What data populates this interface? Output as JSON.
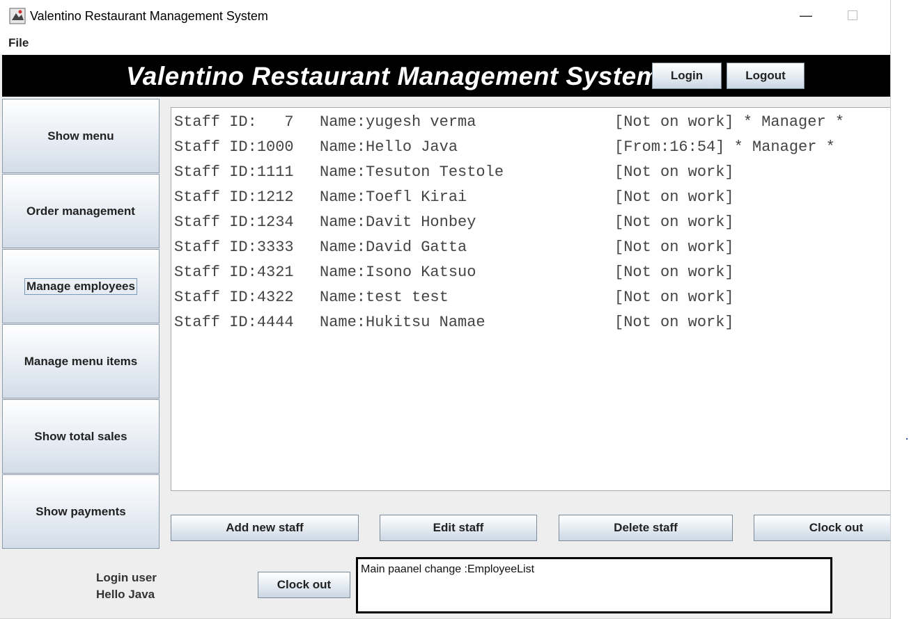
{
  "window": {
    "title": "Valentino Restaurant Management System",
    "minimize_glyph": "—"
  },
  "menubar": {
    "file_label": "File"
  },
  "banner": {
    "title": "Valentino Restaurant Management System",
    "login_label": "Login",
    "logout_label": "Logout"
  },
  "sidebar": {
    "items": [
      {
        "label": "Show menu"
      },
      {
        "label": "Order management"
      },
      {
        "label": "Manage employees"
      },
      {
        "label": "Manage menu items"
      },
      {
        "label": "Show total sales"
      },
      {
        "label": "Show payments"
      }
    ]
  },
  "staff_list": {
    "rows": [
      {
        "id": "Staff ID:   7",
        "name": "Name:yugesh verma",
        "status": "[Not on work] * Manager *"
      },
      {
        "id": "Staff ID:1000",
        "name": "Name:Hello Java",
        "status": "[From:16:54] * Manager *"
      },
      {
        "id": "Staff ID:1111",
        "name": "Name:Tesuton Testole",
        "status": "[Not on work]"
      },
      {
        "id": "Staff ID:1212",
        "name": "Name:Toefl Kirai",
        "status": "[Not on work]"
      },
      {
        "id": "Staff ID:1234",
        "name": "Name:Davit Honbey",
        "status": "[Not on work]"
      },
      {
        "id": "Staff ID:3333",
        "name": "Name:David Gatta",
        "status": "[Not on work]"
      },
      {
        "id": "Staff ID:4321",
        "name": "Name:Isono Katsuo",
        "status": "[Not on work]"
      },
      {
        "id": "Staff ID:4322",
        "name": "Name:test test",
        "status": "[Not on work]"
      },
      {
        "id": "Staff ID:4444",
        "name": "Name:Hukitsu Namae",
        "status": "[Not on work]"
      }
    ]
  },
  "actions": {
    "add_label": "Add new staff",
    "edit_label": "Edit staff",
    "delete_label": "Delete staff",
    "clockout_label": "Clock out"
  },
  "footer": {
    "login_user_label": "Login user",
    "login_user_name": "Hello Java",
    "clockout_label": "Clock out",
    "status_message": "Main paanel change :EmployeeList"
  },
  "colors": {
    "banner_bg": "#000000",
    "banner_text": "#ffffff",
    "window_bg": "#eeeeee"
  }
}
